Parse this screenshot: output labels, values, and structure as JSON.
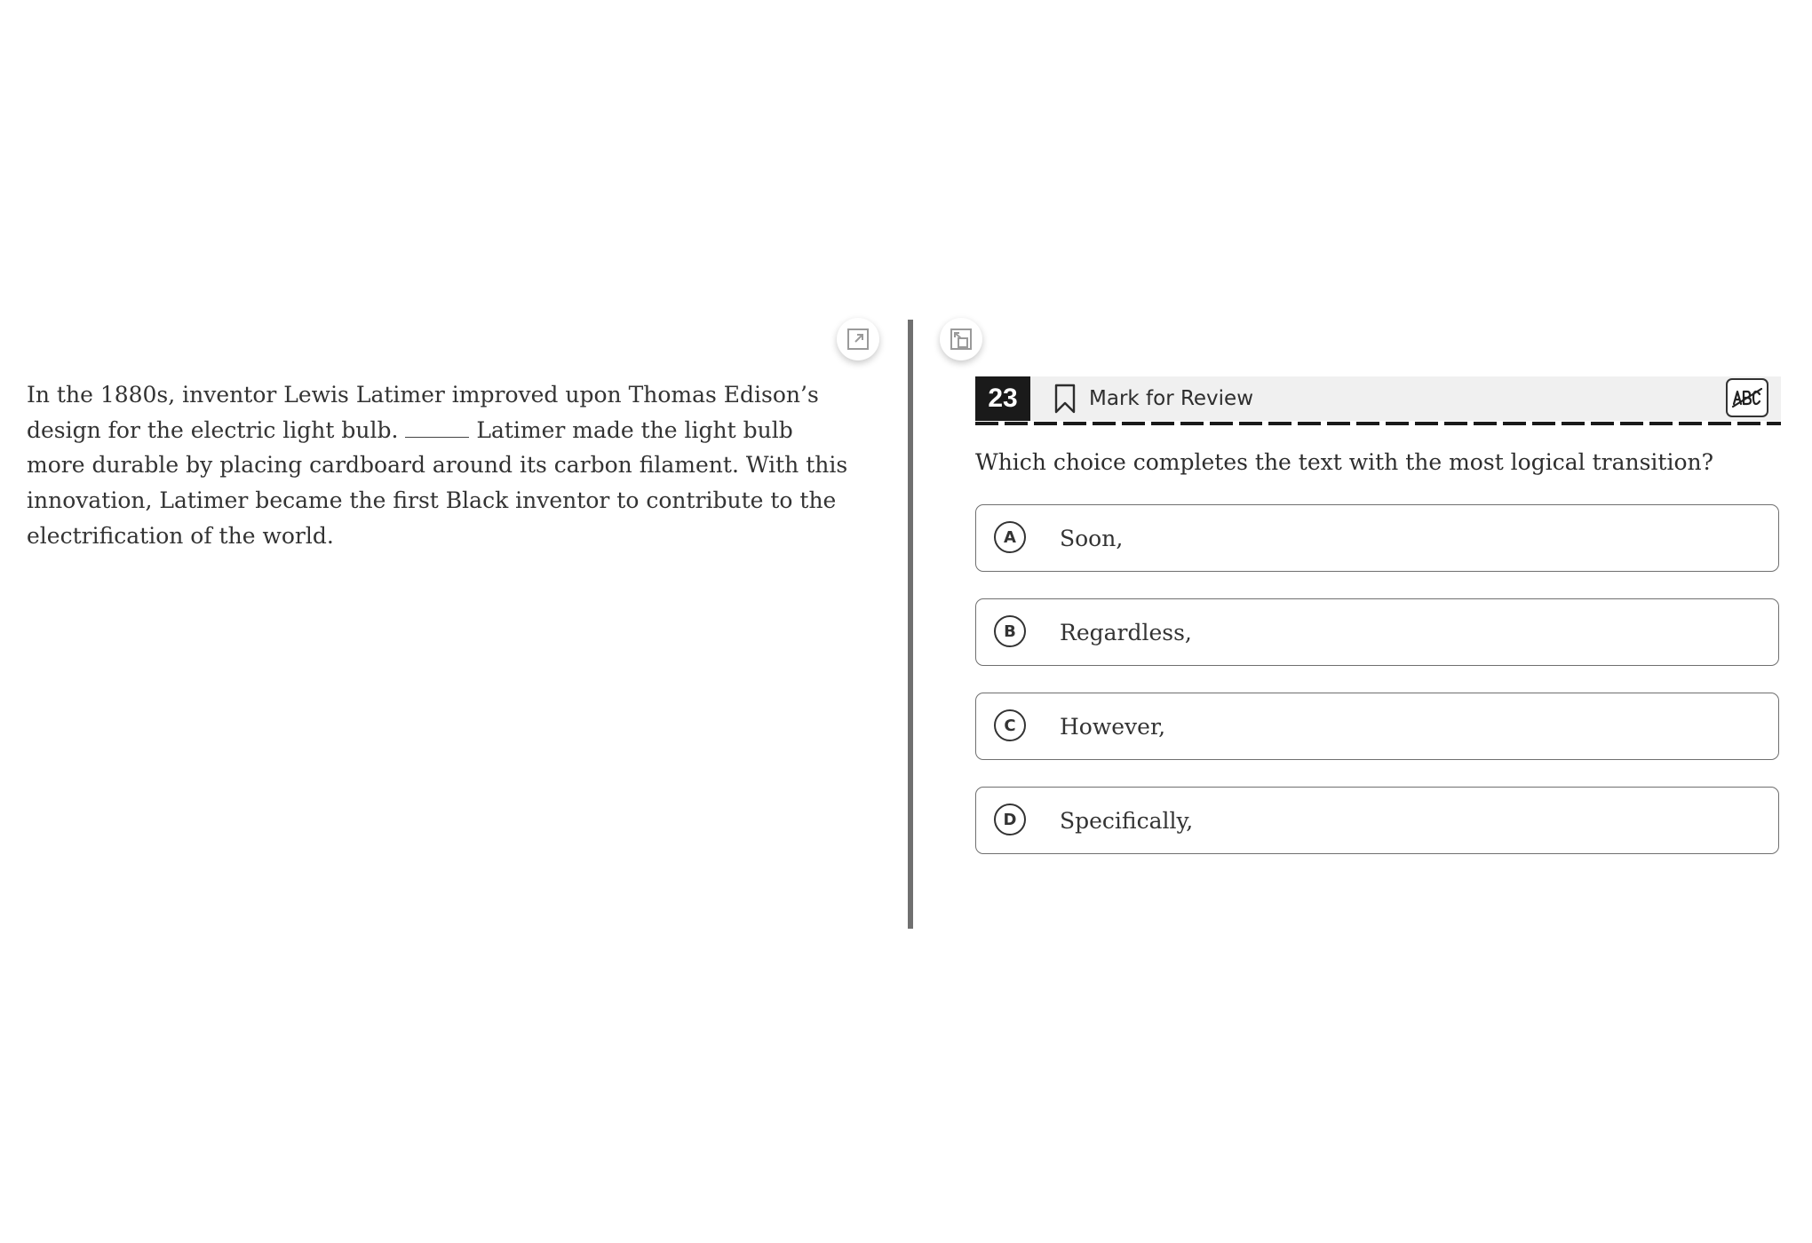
{
  "passage": {
    "text_before_blank": "In the 1880s, inventor Lewis Latimer improved upon Thomas Edison’s design for the electric light bulb. ",
    "blank": "______",
    "text_after_blank": " Latimer made the light bulb more durable by placing cardboard around its carbon filament. With this innovation, Latimer became the first Black inventor to contribute to the electrification of the world."
  },
  "pane_controls": {
    "expand_left_icon": "expand-arrow-icon",
    "expand_right_icon": "collapse-arrow-icon"
  },
  "question": {
    "number": "23",
    "mark_for_review_label": "Mark for Review",
    "mark_icon": "bookmark-icon",
    "abc_tool_icon": "abc-strikethrough-icon",
    "prompt": "Which choice completes the text with the most logical transition?",
    "choices": [
      {
        "letter": "A",
        "text": "Soon,"
      },
      {
        "letter": "B",
        "text": "Regardless,"
      },
      {
        "letter": "C",
        "text": "However,"
      },
      {
        "letter": "D",
        "text": "Specifically,"
      }
    ]
  },
  "colors": {
    "header_bg": "#f0f0f0",
    "number_bg": "#1a1a1a",
    "divider": "#707070",
    "choice_border": "#6f6f6f"
  }
}
